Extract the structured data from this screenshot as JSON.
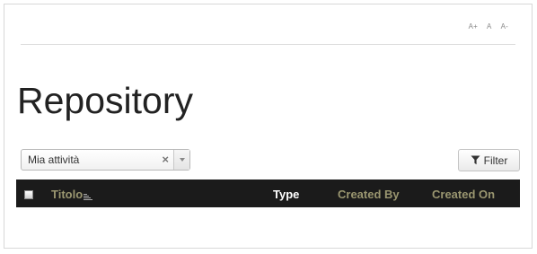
{
  "font_controls": {
    "increase": "A+",
    "reset": "A",
    "decrease": "A-"
  },
  "page_title": "Repository",
  "filter_select": {
    "value": "Mia attività",
    "clear": "×"
  },
  "filter_button": {
    "label": "Filter",
    "icon": "funnel-icon"
  },
  "table": {
    "columns": [
      {
        "label": "Titolo",
        "sortable": true,
        "color": "#9a9670"
      },
      {
        "label": "Type",
        "color": "#ffffff"
      },
      {
        "label": "Created By",
        "color": "#9a9670"
      },
      {
        "label": "Created On",
        "color": "#9a9670"
      }
    ],
    "header_background": "#1b1b1b"
  }
}
